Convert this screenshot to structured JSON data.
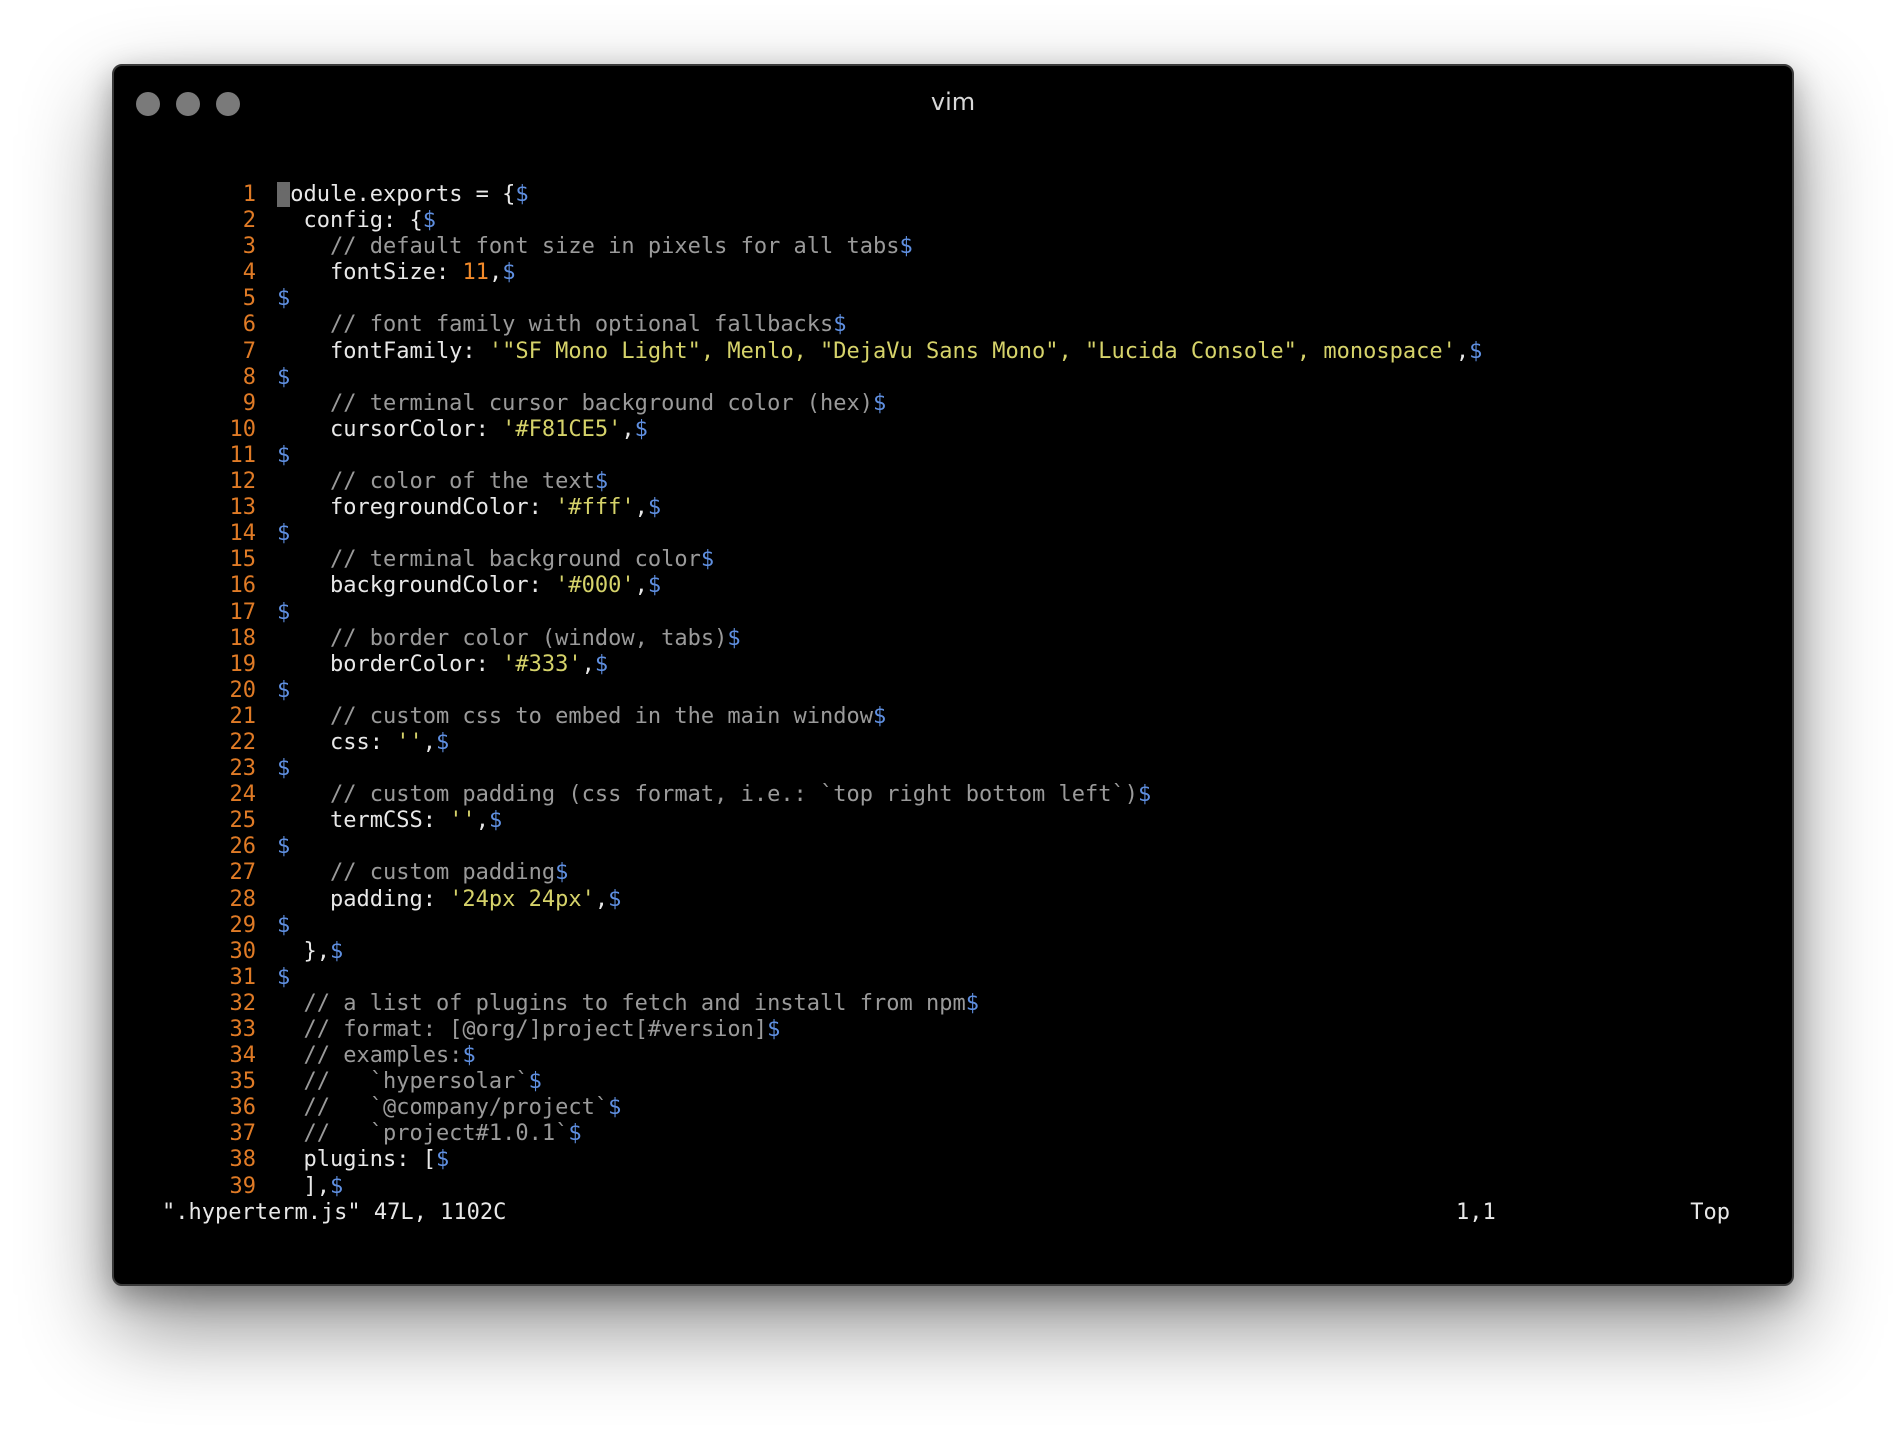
{
  "window": {
    "title": "vim",
    "traffic_lights": [
      "close-button",
      "minimize-button",
      "zoom-button"
    ]
  },
  "colors": {
    "line_number": "#e07b26",
    "plain": "#e8e8e8",
    "comment": "#9a9a9a",
    "string": "#d6d36a",
    "number": "#f28a2a",
    "eol_marker": "#5f8fe0",
    "cursor": "#6a6a6a"
  },
  "editor": {
    "lines": [
      {
        "n": "1",
        "segs": [
          [
            "cursor",
            "m"
          ],
          [
            "plain",
            "odule.exports = {"
          ],
          [
            "eol",
            "$"
          ]
        ]
      },
      {
        "n": "2",
        "segs": [
          [
            "plain",
            "  config: {"
          ],
          [
            "eol",
            "$"
          ]
        ]
      },
      {
        "n": "3",
        "segs": [
          [
            "comment",
            "    // default font size in pixels for all tabs"
          ],
          [
            "eol",
            "$"
          ]
        ]
      },
      {
        "n": "4",
        "segs": [
          [
            "plain",
            "    fontSize: "
          ],
          [
            "number",
            "11"
          ],
          [
            "plain",
            ","
          ],
          [
            "eol",
            "$"
          ]
        ]
      },
      {
        "n": "5",
        "segs": [
          [
            "eol",
            "$"
          ]
        ]
      },
      {
        "n": "6",
        "segs": [
          [
            "comment",
            "    // font family with optional fallbacks"
          ],
          [
            "eol",
            "$"
          ]
        ]
      },
      {
        "n": "7",
        "segs": [
          [
            "plain",
            "    fontFamily: "
          ],
          [
            "string",
            "'\"SF Mono Light\", Menlo, \"DejaVu Sans Mono\", \"Lucida Console\", monospace'"
          ],
          [
            "plain",
            ","
          ],
          [
            "eol",
            "$"
          ]
        ]
      },
      {
        "n": "8",
        "segs": [
          [
            "eol",
            "$"
          ]
        ]
      },
      {
        "n": "9",
        "segs": [
          [
            "comment",
            "    // terminal cursor background color (hex)"
          ],
          [
            "eol",
            "$"
          ]
        ]
      },
      {
        "n": "10",
        "segs": [
          [
            "plain",
            "    cursorColor: "
          ],
          [
            "string",
            "'#F81CE5'"
          ],
          [
            "plain",
            ","
          ],
          [
            "eol",
            "$"
          ]
        ]
      },
      {
        "n": "11",
        "segs": [
          [
            "eol",
            "$"
          ]
        ]
      },
      {
        "n": "12",
        "segs": [
          [
            "comment",
            "    // color of the text"
          ],
          [
            "eol",
            "$"
          ]
        ]
      },
      {
        "n": "13",
        "segs": [
          [
            "plain",
            "    foregroundColor: "
          ],
          [
            "string",
            "'#fff'"
          ],
          [
            "plain",
            ","
          ],
          [
            "eol",
            "$"
          ]
        ]
      },
      {
        "n": "14",
        "segs": [
          [
            "eol",
            "$"
          ]
        ]
      },
      {
        "n": "15",
        "segs": [
          [
            "comment",
            "    // terminal background color"
          ],
          [
            "eol",
            "$"
          ]
        ]
      },
      {
        "n": "16",
        "segs": [
          [
            "plain",
            "    backgroundColor: "
          ],
          [
            "string",
            "'#000'"
          ],
          [
            "plain",
            ","
          ],
          [
            "eol",
            "$"
          ]
        ]
      },
      {
        "n": "17",
        "segs": [
          [
            "eol",
            "$"
          ]
        ]
      },
      {
        "n": "18",
        "segs": [
          [
            "comment",
            "    // border color (window, tabs)"
          ],
          [
            "eol",
            "$"
          ]
        ]
      },
      {
        "n": "19",
        "segs": [
          [
            "plain",
            "    borderColor: "
          ],
          [
            "string",
            "'#333'"
          ],
          [
            "plain",
            ","
          ],
          [
            "eol",
            "$"
          ]
        ]
      },
      {
        "n": "20",
        "segs": [
          [
            "eol",
            "$"
          ]
        ]
      },
      {
        "n": "21",
        "segs": [
          [
            "comment",
            "    // custom css to embed in the main window"
          ],
          [
            "eol",
            "$"
          ]
        ]
      },
      {
        "n": "22",
        "segs": [
          [
            "plain",
            "    css: "
          ],
          [
            "string",
            "''"
          ],
          [
            "plain",
            ","
          ],
          [
            "eol",
            "$"
          ]
        ]
      },
      {
        "n": "23",
        "segs": [
          [
            "eol",
            "$"
          ]
        ]
      },
      {
        "n": "24",
        "segs": [
          [
            "comment",
            "    // custom padding (css format, i.e.: `top right bottom left`)"
          ],
          [
            "eol",
            "$"
          ]
        ]
      },
      {
        "n": "25",
        "segs": [
          [
            "plain",
            "    termCSS: "
          ],
          [
            "string",
            "''"
          ],
          [
            "plain",
            ","
          ],
          [
            "eol",
            "$"
          ]
        ]
      },
      {
        "n": "26",
        "segs": [
          [
            "eol",
            "$"
          ]
        ]
      },
      {
        "n": "27",
        "segs": [
          [
            "comment",
            "    // custom padding"
          ],
          [
            "eol",
            "$"
          ]
        ]
      },
      {
        "n": "28",
        "segs": [
          [
            "plain",
            "    padding: "
          ],
          [
            "string",
            "'24px 24px'"
          ],
          [
            "plain",
            ","
          ],
          [
            "eol",
            "$"
          ]
        ]
      },
      {
        "n": "29",
        "segs": [
          [
            "eol",
            "$"
          ]
        ]
      },
      {
        "n": "30",
        "segs": [
          [
            "plain",
            "  },"
          ],
          [
            "eol",
            "$"
          ]
        ]
      },
      {
        "n": "31",
        "segs": [
          [
            "eol",
            "$"
          ]
        ]
      },
      {
        "n": "32",
        "segs": [
          [
            "comment",
            "  // a list of plugins to fetch and install from npm"
          ],
          [
            "eol",
            "$"
          ]
        ]
      },
      {
        "n": "33",
        "segs": [
          [
            "comment",
            "  // format: [@org/]project[#version]"
          ],
          [
            "eol",
            "$"
          ]
        ]
      },
      {
        "n": "34",
        "segs": [
          [
            "comment",
            "  // examples:"
          ],
          [
            "eol",
            "$"
          ]
        ]
      },
      {
        "n": "35",
        "segs": [
          [
            "comment",
            "  //   `hypersolar`"
          ],
          [
            "eol",
            "$"
          ]
        ]
      },
      {
        "n": "36",
        "segs": [
          [
            "comment",
            "  //   `@company/project`"
          ],
          [
            "eol",
            "$"
          ]
        ]
      },
      {
        "n": "37",
        "segs": [
          [
            "comment",
            "  //   `project#1.0.1`"
          ],
          [
            "eol",
            "$"
          ]
        ]
      },
      {
        "n": "38",
        "segs": [
          [
            "plain",
            "  plugins: ["
          ],
          [
            "eol",
            "$"
          ]
        ]
      },
      {
        "n": "39",
        "segs": [
          [
            "plain",
            "  ],"
          ],
          [
            "eol",
            "$"
          ]
        ]
      }
    ]
  },
  "status": {
    "file_info": "\".hyperterm.js\" 47L, 1102C",
    "cursor_position": "1,1",
    "scroll_position": "Top"
  }
}
